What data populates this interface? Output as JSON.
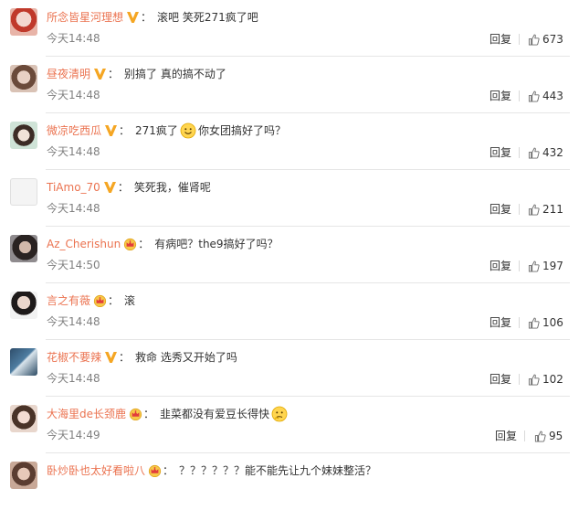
{
  "comments": [
    {
      "user": "所念皆星河理想",
      "badge": "v",
      "text": "滚吧 笑死271疯了吧",
      "time": "今天14:48",
      "reply": "回复",
      "likes": "673"
    },
    {
      "user": "昼夜清明",
      "badge": "v",
      "text": "别搞了 真的搞不动了",
      "time": "今天14:48",
      "reply": "回复",
      "likes": "443"
    },
    {
      "user": "微凉吃西瓜",
      "badge": "v",
      "text_before": "271疯了",
      "emoji": "smile-emoji",
      "text_after": "你女团搞好了吗？",
      "time": "今天14:48",
      "reply": "回复",
      "likes": "432"
    },
    {
      "user": "TiAmo_70",
      "badge": "v",
      "text": "笑死我，催肾呢",
      "time": "今天14:48",
      "reply": "回复",
      "likes": "211"
    },
    {
      "user": "Az_Cherishun",
      "badge": "crown",
      "text": "有病吧？the9搞好了吗？",
      "time": "今天14:50",
      "reply": "回复",
      "likes": "197"
    },
    {
      "user": "言之有薇",
      "badge": "crown",
      "text": "滚",
      "time": "今天14:48",
      "reply": "回复",
      "likes": "106"
    },
    {
      "user": "花椒不要辣",
      "badge": "v",
      "text": "救命 选秀又开始了吗",
      "time": "今天14:48",
      "reply": "回复",
      "likes": "102"
    },
    {
      "user": "大海里de长颈鹿",
      "badge": "crown",
      "text_before": "韭菜都没有爱豆长得快",
      "emoji": "thinking-emoji",
      "text_after": "",
      "time": "今天14:49",
      "reply": "回复",
      "likes": "95"
    },
    {
      "user": "卧炒卧也太好看啦八",
      "badge": "crown",
      "text": "？？？？？？能不能先让九个妹妹整活？",
      "time": "",
      "reply": "",
      "likes": ""
    }
  ],
  "colors": {
    "username": "#eb7350",
    "text": "#333333",
    "time": "#808080",
    "badge_gold": "#f5a623"
  }
}
